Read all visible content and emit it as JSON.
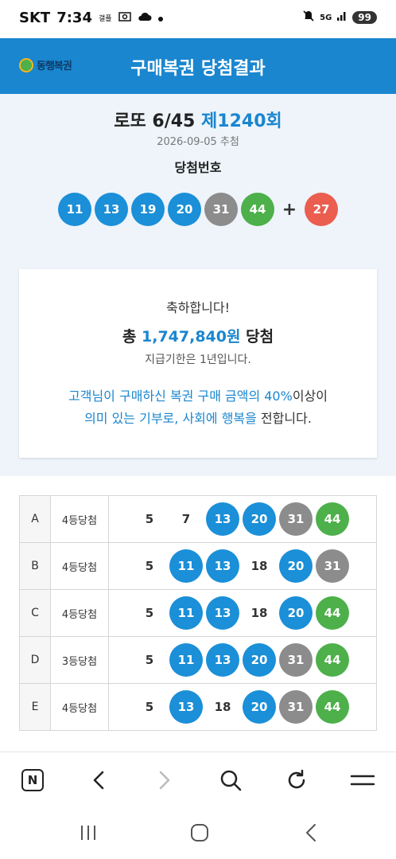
{
  "status_bar": {
    "carrier": "SKT",
    "time": "7:34",
    "small_label": "갤플",
    "network": "5G",
    "battery": "99"
  },
  "header": {
    "logo_text": "동행복권",
    "title": "구매복권 당첨결과"
  },
  "draw": {
    "game": "로또 6/45",
    "round": "제1240회",
    "date": "2026-09-05 추첨",
    "winning_label": "당첨번호",
    "winning_numbers": [
      {
        "n": "11",
        "color": "#1b8fd8"
      },
      {
        "n": "13",
        "color": "#1b8fd8"
      },
      {
        "n": "19",
        "color": "#1b8fd8"
      },
      {
        "n": "20",
        "color": "#1b8fd8"
      },
      {
        "n": "31",
        "color": "#8c8c8c"
      },
      {
        "n": "44",
        "color": "#4db04a"
      }
    ],
    "plus": "+",
    "bonus": {
      "n": "27",
      "color": "#ea5d4f"
    }
  },
  "prize": {
    "congrats": "축하합니다!",
    "total_prefix": "총",
    "total_amount": "1,747,840원",
    "total_suffix": "당첨",
    "deadline": "지급기한은 1년입니다.",
    "donation_a": "고객님이 구매하신 복권 구매 금액의 40%",
    "donation_b": "이상이",
    "donation_c": "의미 있는 기부로, 사회에 행복을",
    "donation_d": "전합니다."
  },
  "tickets": [
    {
      "game": "A",
      "rank": "4등당첨",
      "numbers": [
        {
          "n": "5",
          "hit": false
        },
        {
          "n": "7",
          "hit": false
        },
        {
          "n": "13",
          "hit": true,
          "color": "#1b8fd8"
        },
        {
          "n": "20",
          "hit": true,
          "color": "#1b8fd8"
        },
        {
          "n": "31",
          "hit": true,
          "color": "#8c8c8c"
        },
        {
          "n": "44",
          "hit": true,
          "color": "#4db04a"
        }
      ]
    },
    {
      "game": "B",
      "rank": "4등당첨",
      "numbers": [
        {
          "n": "5",
          "hit": false
        },
        {
          "n": "11",
          "hit": true,
          "color": "#1b8fd8"
        },
        {
          "n": "13",
          "hit": true,
          "color": "#1b8fd8"
        },
        {
          "n": "18",
          "hit": false
        },
        {
          "n": "20",
          "hit": true,
          "color": "#1b8fd8"
        },
        {
          "n": "31",
          "hit": true,
          "color": "#8c8c8c"
        }
      ]
    },
    {
      "game": "C",
      "rank": "4등당첨",
      "numbers": [
        {
          "n": "5",
          "hit": false
        },
        {
          "n": "11",
          "hit": true,
          "color": "#1b8fd8"
        },
        {
          "n": "13",
          "hit": true,
          "color": "#1b8fd8"
        },
        {
          "n": "18",
          "hit": false
        },
        {
          "n": "20",
          "hit": true,
          "color": "#1b8fd8"
        },
        {
          "n": "44",
          "hit": true,
          "color": "#4db04a"
        }
      ]
    },
    {
      "game": "D",
      "rank": "3등당첨",
      "numbers": [
        {
          "n": "5",
          "hit": false
        },
        {
          "n": "11",
          "hit": true,
          "color": "#1b8fd8"
        },
        {
          "n": "13",
          "hit": true,
          "color": "#1b8fd8"
        },
        {
          "n": "20",
          "hit": true,
          "color": "#1b8fd8"
        },
        {
          "n": "31",
          "hit": true,
          "color": "#8c8c8c"
        },
        {
          "n": "44",
          "hit": true,
          "color": "#4db04a"
        }
      ]
    },
    {
      "game": "E",
      "rank": "4등당첨",
      "numbers": [
        {
          "n": "5",
          "hit": false
        },
        {
          "n": "13",
          "hit": true,
          "color": "#1b8fd8"
        },
        {
          "n": "18",
          "hit": false
        },
        {
          "n": "20",
          "hit": true,
          "color": "#1b8fd8"
        },
        {
          "n": "31",
          "hit": true,
          "color": "#8c8c8c"
        },
        {
          "n": "44",
          "hit": true,
          "color": "#4db04a"
        }
      ]
    }
  ],
  "browser_toolbar": {
    "home_letter": "N",
    "items": [
      "naver-home-icon",
      "back-arrow-icon",
      "forward-arrow-icon",
      "search-icon",
      "refresh-icon",
      "menu-icon"
    ]
  },
  "system_nav": [
    "recent-apps-icon",
    "home-icon",
    "back-icon"
  ]
}
